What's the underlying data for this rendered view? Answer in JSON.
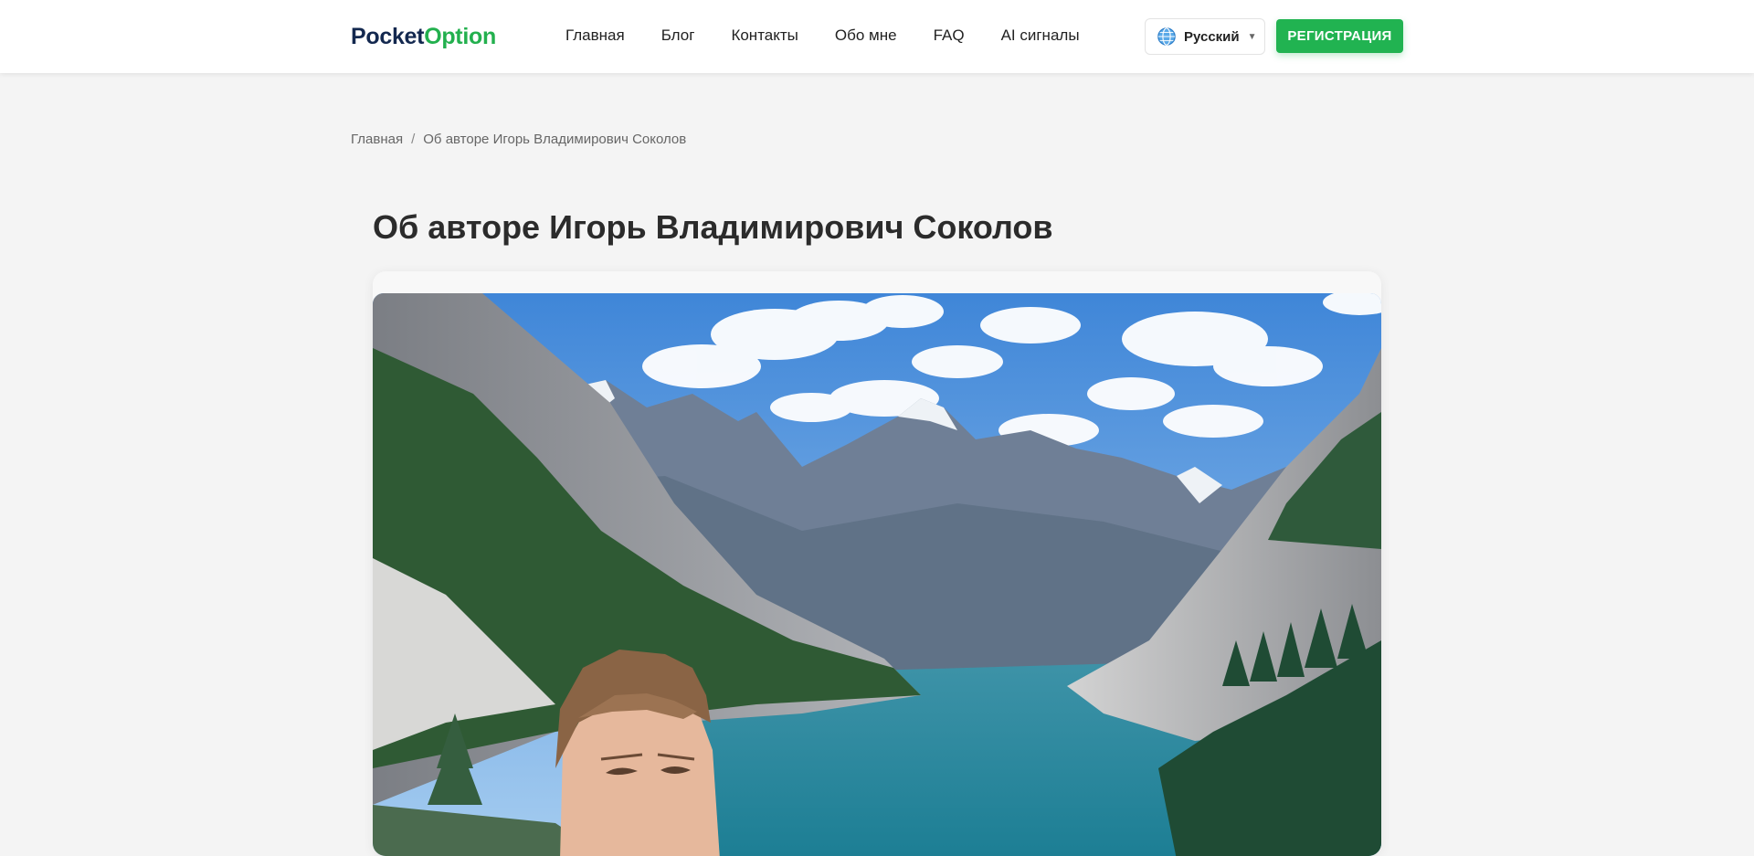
{
  "header": {
    "logo_part1": "Pocket",
    "logo_part2": "Option",
    "nav": [
      "Главная",
      "Блог",
      "Контакты",
      "Обо мне",
      "FAQ",
      "AI сигналы"
    ],
    "language": "Русский",
    "language_icon": "globe-icon",
    "caret_icon": "▼",
    "register_label": "РЕГИСТРАЦИЯ"
  },
  "breadcrumb": {
    "home": "Главная",
    "separator": "/",
    "current": "Об авторе Игорь Владимирович Соколов"
  },
  "page": {
    "title": "Об авторе Игорь Владимирович Соколов"
  },
  "colors": {
    "brand_dark": "#13284f",
    "brand_green": "#23b04e",
    "button_green": "#21b351",
    "background": "#f4f4f4"
  }
}
